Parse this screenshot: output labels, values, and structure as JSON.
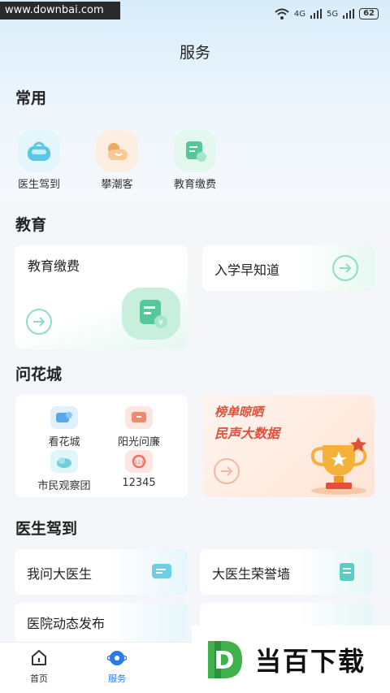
{
  "watermark": "www.downbai.com",
  "status": {
    "battery": "62",
    "net1": "4G",
    "net2": "5G"
  },
  "page_title": "服务",
  "common": {
    "title": "常用",
    "items": [
      {
        "label": "医生驾到",
        "icon": "doctor-bag-icon"
      },
      {
        "label": "攀潮客",
        "icon": "sun-cloud-icon"
      },
      {
        "label": "教育缴费",
        "icon": "payment-card-icon"
      }
    ]
  },
  "education": {
    "title": "教育",
    "card_pay": "教育缴费",
    "card_enroll": "入学早知道"
  },
  "wenhuacheng": {
    "title": "问花城",
    "grid": [
      {
        "label": "看花城",
        "icon": "video-chat-icon"
      },
      {
        "label": "阳光问廉",
        "icon": "tv-icon"
      },
      {
        "label": "市民观察团",
        "icon": "cloud-icon"
      },
      {
        "label": "12345",
        "icon": "hotline-icon"
      }
    ],
    "banner_line1": "榜单晾晒",
    "banner_line2": "民声大数据"
  },
  "doctor": {
    "title": "医生驾到",
    "items": [
      "我问大医生",
      "大医生荣誉墙",
      "医院动态发布"
    ]
  },
  "tabs": [
    {
      "label": "首页",
      "icon": "home-icon"
    },
    {
      "label": "服务",
      "icon": "service-icon"
    }
  ],
  "brand": {
    "text": "当百下载",
    "logo_letter": "D"
  },
  "colors": {
    "accent": "#2a7be4",
    "mint": "#8fdcc7",
    "banner_red": "#e0503a",
    "trophy": "#f4b23a"
  }
}
